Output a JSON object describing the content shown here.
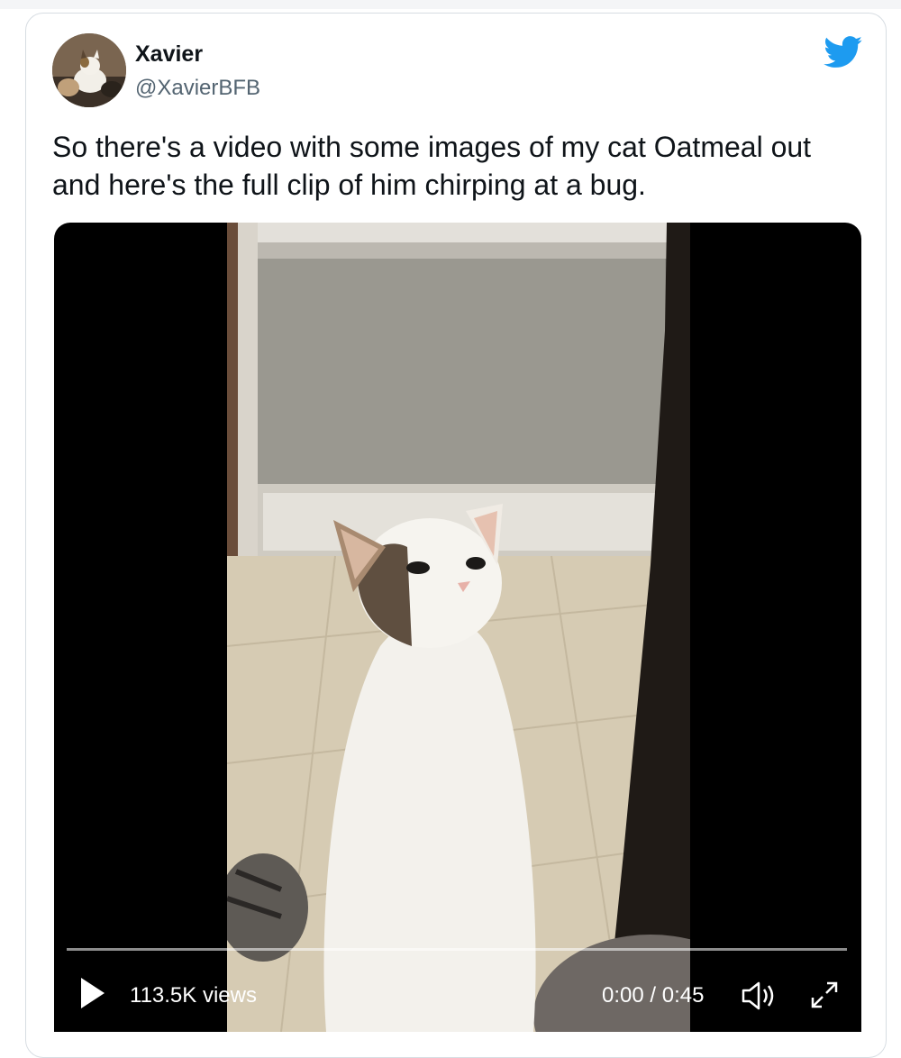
{
  "tweet": {
    "author_name": "Xavier",
    "author_handle": "@XavierBFB",
    "text": "So there's a video with some images of my cat Oatmeal out and here's the full clip of him chirping at a bug."
  },
  "video": {
    "views": "113.5K views",
    "time": "0:00 / 0:45",
    "progress": 0
  },
  "icons": {
    "brand": "twitter-bird-icon",
    "play": "play-icon",
    "volume": "volume-icon",
    "fullscreen": "expand-icon"
  },
  "colors": {
    "brand_blue": "#1d9bf0",
    "name": "#0f1419",
    "handle": "#536471"
  }
}
